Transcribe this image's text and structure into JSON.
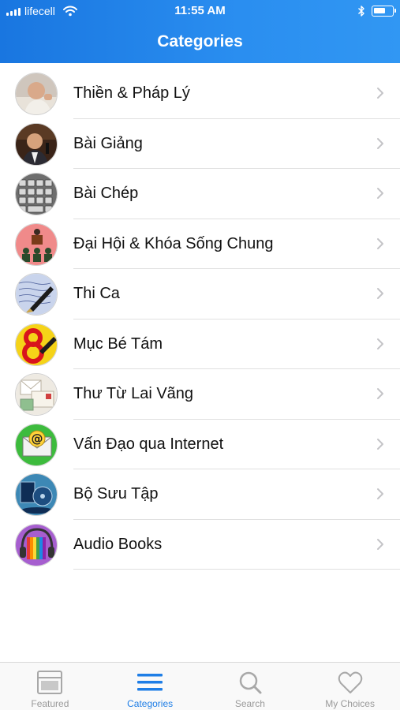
{
  "status_bar": {
    "carrier": "lifecell",
    "time": "11:55 AM",
    "battery_level": 0.65
  },
  "nav": {
    "title": "Categories"
  },
  "colors": {
    "accent": "#1f7ee6",
    "header_start": "#1976e0",
    "header_end": "#3197f3",
    "inactive": "#9a9a9a"
  },
  "categories": [
    {
      "label": "Thiền & Pháp Lý",
      "icon": "monk-portrait-icon"
    },
    {
      "label": "Bài Giảng",
      "icon": "speaker-portrait-icon"
    },
    {
      "label": "Bài Chép",
      "icon": "keyboard-icon"
    },
    {
      "label": "Đại Hội & Khóa Sống Chung",
      "icon": "assembly-podium-icon"
    },
    {
      "label": "Thi Ca",
      "icon": "fountain-pen-icon"
    },
    {
      "label": "Mục Bé Tám",
      "icon": "number-eight-pen-icon"
    },
    {
      "label": "Thư Từ Lai Vãng",
      "icon": "letters-envelope-icon"
    },
    {
      "label": "Vấn Đạo qua Internet",
      "icon": "email-at-icon"
    },
    {
      "label": "Bộ Sưu Tập",
      "icon": "collection-discs-icon"
    },
    {
      "label": "Audio Books",
      "icon": "headphones-books-icon"
    }
  ],
  "tabs": [
    {
      "label": "Featured",
      "icon": "featured-icon",
      "active": false
    },
    {
      "label": "Categories",
      "icon": "list-icon",
      "active": true
    },
    {
      "label": "Search",
      "icon": "search-icon",
      "active": false
    },
    {
      "label": "My Choices",
      "icon": "heart-icon",
      "active": false
    }
  ]
}
